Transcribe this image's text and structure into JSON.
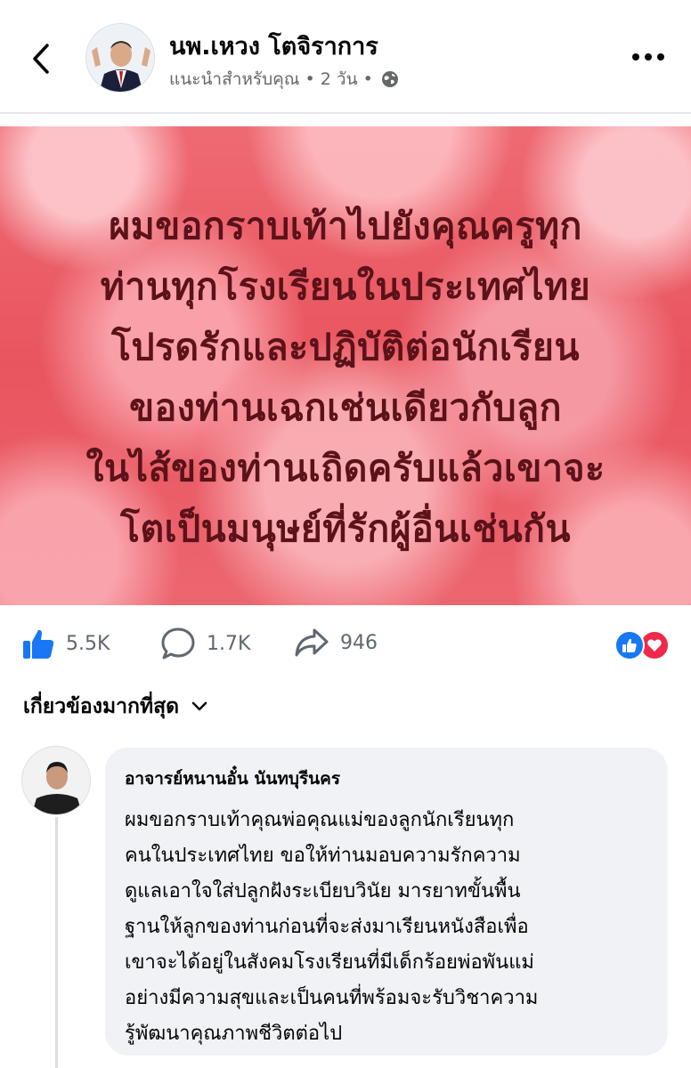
{
  "header": {
    "author_name": "นพ.เหวง โตจิราการ",
    "meta_text": "แนะนำสำหรับคุณ • 2 วัน •"
  },
  "post": {
    "image_text_lines": [
      "ผมขอกราบเท้าไปยังคุณครูทุก",
      "ท่านทุกโรงเรียนในประเทศไทย",
      "โปรดรักและปฏิบัติต่อนักเรียน",
      "ของท่านเฉกเช่นเดียวกับลูก",
      "ในไส้ของท่านเถิดครับแล้วเขาจะ",
      "โตเป็นมนุษย์ที่รักผู้อื่นเช่นกัน"
    ],
    "likes": "5.5K",
    "comments": "1.7K",
    "shares": "946"
  },
  "sort": {
    "label": "เกี่ยวข้องมากที่สุด"
  },
  "comment": {
    "author": "อาจารย์หนานอั๋น นันทบุรีนคร",
    "lines": [
      "ผมขอกราบเท้าคุณพ่อคุณแม่ของลูกนักเรียนทุก",
      "คนในประเทศไทย ขอให้ท่านมอบความรักความ",
      "ดูแลเอาใจใส่ปลูกฝังระเบียบวินัย มารยาทขั้นพื้น",
      "ฐานให้ลูกของท่านก่อนที่จะส่งมาเรียนหนังสือเพื่อ",
      "เขาจะได้อยู่ในสังคมโรงเรียนที่มีเด็กร้อยพ่อพันแม่",
      "อย่างมีความสุขและเป็นคนที่พร้อมจะรับวิชาความ",
      "รู้พัฒนาคุณภาพชีวิตต่อไป"
    ]
  },
  "icons": {
    "back": "chevron-left-icon",
    "more": "more-horizontal-icon",
    "privacy": "globe-icon",
    "like": "thumbs-up-icon",
    "comment": "comment-bubble-icon",
    "share": "share-arrow-icon",
    "sort": "chevron-down-icon"
  },
  "colors": {
    "facebook_blue": "#1877f2",
    "love_red": "#f02849",
    "post_background": "#e9555f",
    "post_text": "#5b1219",
    "comment_bubble": "#f0f2f5"
  }
}
